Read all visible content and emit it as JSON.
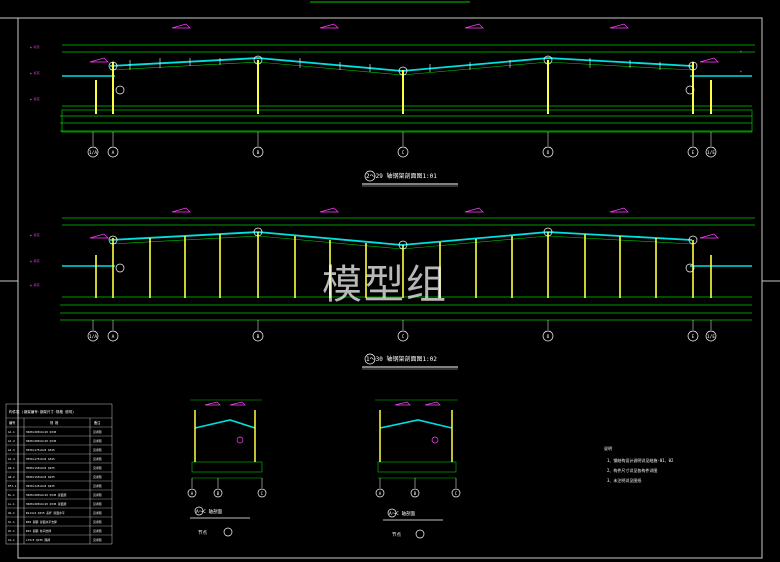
{
  "watermark": "模型组",
  "colors": {
    "background": "#000000",
    "frame": "#00c800",
    "rafter": "#00e0e0",
    "column": "#ffff40",
    "magenta": "#ff40ff",
    "axis": "#ffffff",
    "dim": "#00c800"
  },
  "elevation_1": {
    "title": "2～29 轴钢架剖面图1:01",
    "axis_labels": [
      "1/A",
      "A",
      "B",
      "C",
      "D",
      "E",
      "1/E"
    ]
  },
  "elevation_2": {
    "title": "1～30 轴钢架剖面图1:02",
    "axis_labels": [
      "1/A",
      "A",
      "B",
      "C",
      "D",
      "E",
      "1/E"
    ]
  },
  "detail_1": {
    "title": "A～C 轴剖面",
    "scale": "节点",
    "axis_labels": [
      "A",
      "B",
      "C"
    ]
  },
  "detail_2": {
    "title": "A～C 轴剖面",
    "scale": "节点",
    "axis_labels": [
      "A",
      "B",
      "C"
    ]
  },
  "notes": {
    "heading": "说明",
    "items": [
      "1、钢结构设计说明详见结施-01、02",
      "2、构件尺寸详见各构件详图",
      "3、未注明详见图纸"
    ]
  },
  "table": {
    "title": "构件表  (钢架编号·钢架尺寸·规格  说明)",
    "headers": [
      "编号",
      "规  格",
      "备注"
    ],
    "rows": [
      [
        "GJ-1",
        "H400×200×6×10 Q345",
        "见详图"
      ],
      [
        "GJ-2",
        "H400×200×6×10 Q345",
        "见详图"
      ],
      [
        "GJ-3",
        "H350×175×6×8 Q345",
        "见详图"
      ],
      [
        "GJ-4",
        "H350×175×6×8 Q345",
        "见详图"
      ],
      [
        "GZ-1",
        "H300×150×6×8 Q235",
        "见详图"
      ],
      [
        "GZ-2",
        "H300×150×6×8 Q235",
        "见详图"
      ],
      [
        "KFJ-1",
        "H250×125×6×8 Q235",
        "见详图"
      ],
      [
        "KL-1",
        "H400×200×6×10 Q345 屋面梁",
        "见详图"
      ],
      [
        "LL-1",
        "H400×200×6×10 Q345 屋面梁",
        "见详图"
      ],
      [
        "XG-1",
        "Φ114×4 Q235 系杆 屋面水平",
        "见详图"
      ],
      [
        "SC-1",
        "Φ20 圆钢 屋面水平支撑",
        "见详图"
      ],
      [
        "ZC-1",
        "Φ25 圆钢 柱间支撑",
        "见详图"
      ],
      [
        "CG-1",
        "L75×5 Q235 隅撑",
        "见详图"
      ]
    ]
  }
}
